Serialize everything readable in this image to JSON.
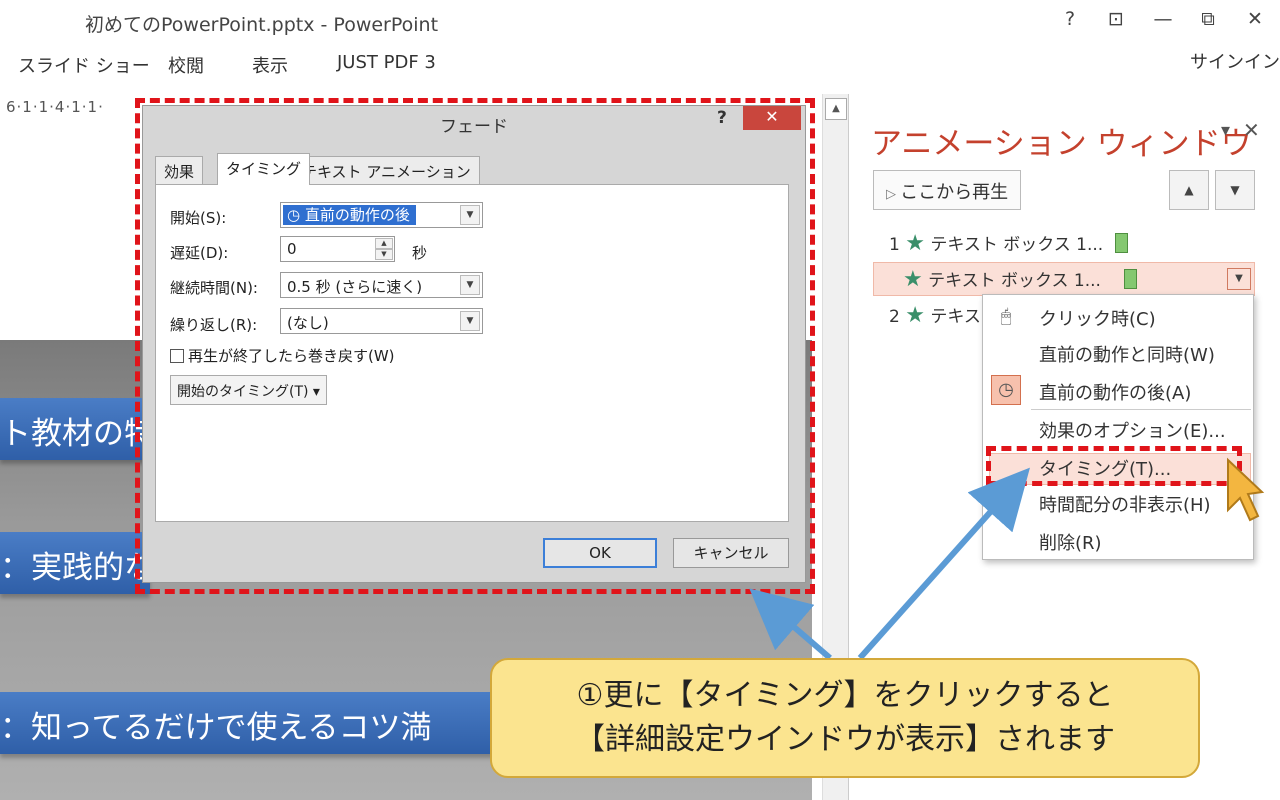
{
  "window": {
    "title": "初めてのPowerPoint.pptx - PowerPoint",
    "help": "?",
    "restore": "⊡",
    "minimize": "—",
    "maximize": "⧉",
    "close": "✕"
  },
  "ribbon": {
    "tabs": [
      "スライド ショー",
      "校閲",
      "表示",
      "JUST PDF 3"
    ],
    "signin": "サインイン"
  },
  "editor": {
    "ruler": "6·1·1·4·1·1·",
    "scroll_up": "▲",
    "slide_lines": [
      "ト教材の特",
      "：実践的な",
      "：知ってるだけで使えるコツ満"
    ]
  },
  "dialog": {
    "title": "フェード",
    "help": "?",
    "close": "✕",
    "tabs": [
      "効果",
      "タイミング",
      "テキスト アニメーション"
    ],
    "active_tab": "タイミング",
    "fields": {
      "start_label": "開始(S):",
      "start_value": "直前の動作の後",
      "delay_label": "遅延(D):",
      "delay_value": "0",
      "delay_unit": "秒",
      "duration_label": "継続時間(N):",
      "duration_value": "0.5 秒 (さらに速く)",
      "repeat_label": "繰り返し(R):",
      "repeat_value": "(なし)"
    },
    "rewind_label": "再生が終了したら巻き戻す(W)",
    "triggers_label": "開始のタイミング(T) ▾",
    "ok": "OK",
    "cancel": "キャンセル"
  },
  "pane": {
    "title": "アニメーション ウィンドウ",
    "menu_icon": "▾",
    "close": "✕",
    "play_label": "ここから再生",
    "move_up": "▲",
    "move_down": "▼",
    "items": [
      {
        "num": "1",
        "label": "テキスト ボックス 1..."
      },
      {
        "num": "",
        "label": "テキスト ボックス 1..."
      },
      {
        "num": "2",
        "label": "テキス"
      }
    ],
    "item_dropdown": "▼"
  },
  "context_menu": {
    "items": [
      "クリック時(C)",
      "直前の動作と同時(W)",
      "直前の動作の後(A)",
      "効果のオプション(E)...",
      "タイミング(T)...",
      "時間配分の非表示(H)",
      "削除(R)"
    ]
  },
  "callout": {
    "line1": "①更に【タイミング】をクリックすると",
    "line2": "【詳細設定ウインドウが表示】されます"
  },
  "colors": {
    "highlight_red": "#e0141a",
    "pane_title": "#c4412d",
    "callout_fill": "#fbe48f",
    "arrow": "#5b9bd5"
  }
}
